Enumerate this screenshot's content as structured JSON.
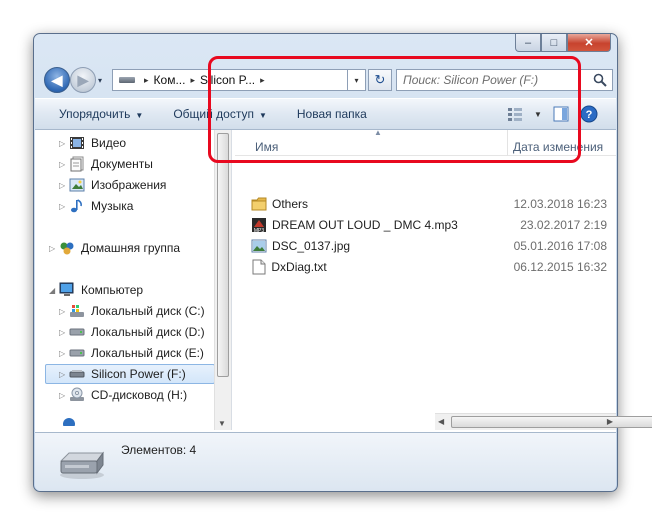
{
  "window": {
    "controls": {
      "minimize": "–",
      "maximize": "□",
      "close": "✕"
    }
  },
  "nav": {
    "back_icon": "arrow-left-icon",
    "forward_icon": "arrow-right-icon",
    "recent_dropdown": "▾"
  },
  "address": {
    "segments": [
      "Ком...",
      "Silicon P..."
    ],
    "separator": "▸",
    "dropdown": "▾",
    "refresh_icon": "↻"
  },
  "search": {
    "placeholder": "Поиск: Silicon Power (F:)"
  },
  "toolbar": {
    "organize": "Упорядочить",
    "share": "Общий доступ",
    "new_folder": "Новая папка",
    "dropdown_arrow": "▼"
  },
  "sidebar": {
    "items": [
      {
        "label": "Видео",
        "icon": "video-icon"
      },
      {
        "label": "Документы",
        "icon": "documents-icon"
      },
      {
        "label": "Изображения",
        "icon": "pictures-icon"
      },
      {
        "label": "Музыка",
        "icon": "music-icon"
      },
      {
        "label": "Домашняя группа",
        "icon": "homegroup-icon"
      },
      {
        "label": "Компьютер",
        "icon": "computer-icon"
      },
      {
        "label": "Локальный диск (C:)",
        "icon": "system-drive-icon"
      },
      {
        "label": "Локальный диск (D:)",
        "icon": "drive-icon"
      },
      {
        "label": "Локальный диск (E:)",
        "icon": "drive-icon"
      },
      {
        "label": "Silicon Power (F:)",
        "icon": "usb-drive-icon",
        "selected": true
      },
      {
        "label": "CD-дисковод (H:)",
        "icon": "cd-drive-icon"
      }
    ]
  },
  "filelist": {
    "columns": {
      "name": "Имя",
      "date": "Дата изменения"
    },
    "rows": [
      {
        "name": "Others",
        "date": "12.03.2018 16:23",
        "icon": "folder-icon"
      },
      {
        "name": "DREAM OUT LOUD _ DMC 4.mp3",
        "date": "23.02.2017 2:19",
        "icon": "mp3-file-icon"
      },
      {
        "name": "DSC_0137.jpg",
        "date": "05.01.2016 17:08",
        "icon": "image-file-icon"
      },
      {
        "name": "DxDiag.txt",
        "date": "06.12.2015 16:32",
        "icon": "text-file-icon"
      }
    ]
  },
  "details": {
    "count": "Элементов: 4"
  },
  "colors": {
    "highlight": "#e8091f",
    "selection": "#d3e6fa"
  }
}
